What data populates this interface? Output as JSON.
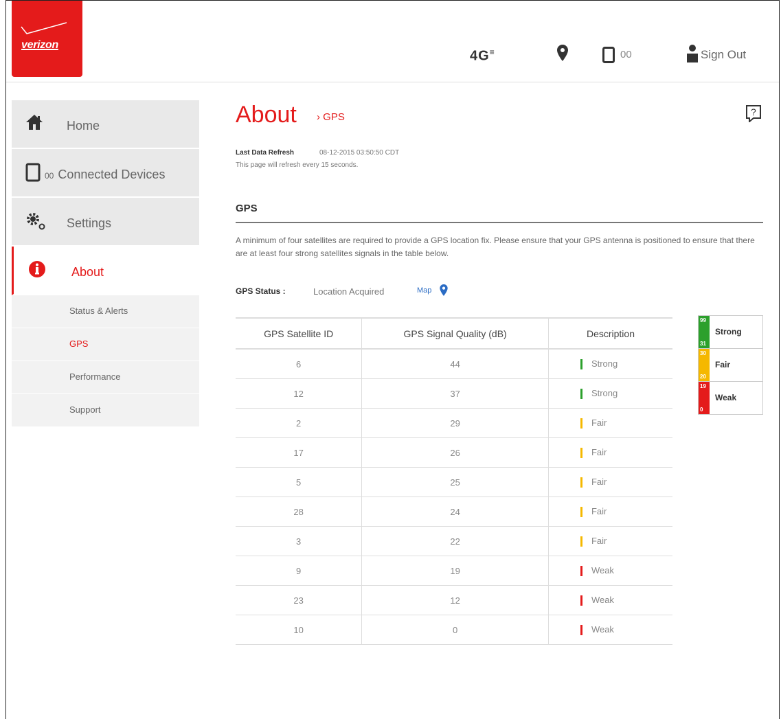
{
  "header": {
    "logo_text": "verizon",
    "network": "4G",
    "network_suffix": "≡",
    "device_count": "00",
    "signout_label": "Sign Out"
  },
  "sidebar": {
    "items": [
      {
        "label": "Home",
        "icon": "home-icon"
      },
      {
        "label": "Connected Devices",
        "prefix": "00",
        "icon": "phone-icon"
      },
      {
        "label": "Settings",
        "icon": "gear-icon"
      },
      {
        "label": "About",
        "icon": "info-icon",
        "active": true
      }
    ],
    "sub_items": [
      {
        "label": "Status & Alerts"
      },
      {
        "label": "GPS",
        "active": true
      },
      {
        "label": "Performance"
      },
      {
        "label": "Support"
      }
    ]
  },
  "main": {
    "title": "About",
    "breadcrumb": "› GPS",
    "refresh_label": "Last Data Refresh",
    "refresh_value": "08-12-2015 03:50:50 CDT",
    "refresh_note": "This page will refresh every 15 seconds.",
    "section_title": "GPS",
    "description": "A minimum of four satellites are required to provide a GPS location fix. Please ensure that your GPS antenna is positioned to ensure that there are at least four strong satellites signals in the table below.",
    "status_label": "GPS Status :",
    "status_value": "Location Acquired",
    "map_label": "Map"
  },
  "table": {
    "headers": [
      "GPS Satellite ID",
      "GPS Signal Quality (dB)",
      "Description"
    ],
    "rows": [
      {
        "id": "6",
        "quality": "44",
        "desc": "Strong"
      },
      {
        "id": "12",
        "quality": "37",
        "desc": "Strong"
      },
      {
        "id": "2",
        "quality": "29",
        "desc": "Fair"
      },
      {
        "id": "17",
        "quality": "26",
        "desc": "Fair"
      },
      {
        "id": "5",
        "quality": "25",
        "desc": "Fair"
      },
      {
        "id": "28",
        "quality": "24",
        "desc": "Fair"
      },
      {
        "id": "3",
        "quality": "22",
        "desc": "Fair"
      },
      {
        "id": "9",
        "quality": "19",
        "desc": "Weak"
      },
      {
        "id": "23",
        "quality": "12",
        "desc": "Weak"
      },
      {
        "id": "10",
        "quality": "0",
        "desc": "Weak"
      }
    ]
  },
  "legend": [
    {
      "label": "Strong",
      "high": "99",
      "low": "31",
      "color": "#2ca02c"
    },
    {
      "label": "Fair",
      "high": "30",
      "low": "20",
      "color": "#f5b800"
    },
    {
      "label": "Weak",
      "high": "19",
      "low": "0",
      "color": "#e41b1b"
    }
  ],
  "colors": {
    "brand": "#e41b1b",
    "strong": "#2ca02c",
    "fair": "#f5b800",
    "weak": "#e41b1b",
    "link": "#2b6cc4"
  }
}
